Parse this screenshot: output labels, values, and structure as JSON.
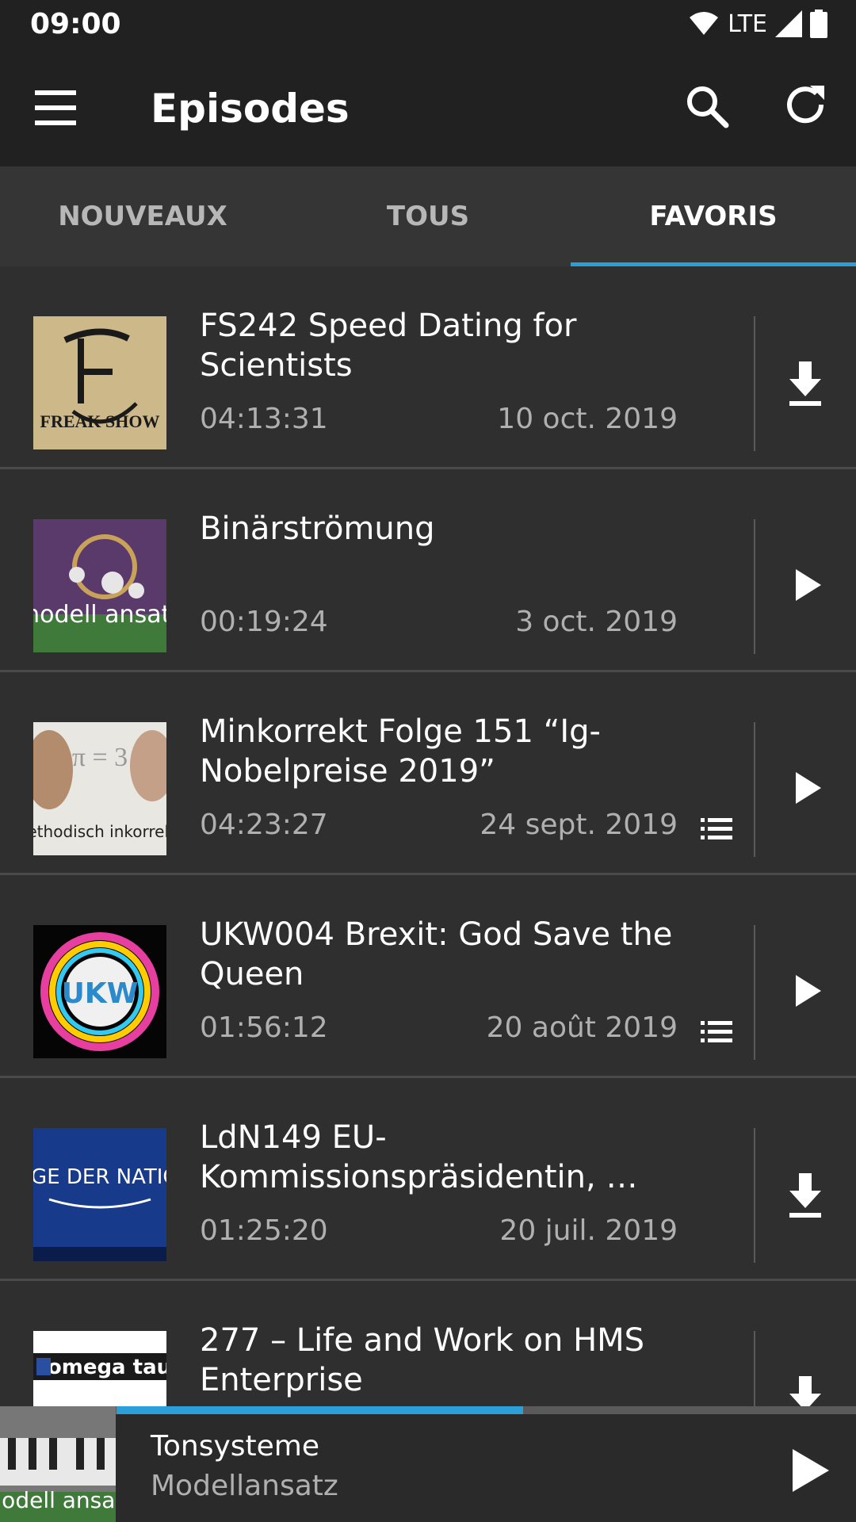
{
  "status_bar": {
    "time": "09:00",
    "network": "LTE",
    "icons": [
      "wifi-icon",
      "signal-icon",
      "battery-icon"
    ]
  },
  "toolbar": {
    "title": "Episodes",
    "icons": [
      "menu-icon",
      "search-icon",
      "refresh-icon"
    ]
  },
  "tabs": [
    {
      "label": "NOUVEAUX",
      "active": false
    },
    {
      "label": "TOUS",
      "active": false
    },
    {
      "label": "FAVORIS",
      "active": true
    }
  ],
  "episodes": [
    {
      "title": "FS242 Speed Dating for Scientists",
      "duration": "04:13:31",
      "date": "10 oct. 2019",
      "action": "download-icon",
      "has_chapters": false,
      "thumb_text": "FREAK SHOW"
    },
    {
      "title": "Binärströmung",
      "duration": "00:19:24",
      "date": "3 oct. 2019",
      "action": "play-icon",
      "has_chapters": false,
      "thumb_text": "modell ansatz"
    },
    {
      "title": "Minkorrekt Folge 151 “Ig-Nobelpreise 2019”",
      "duration": "04:23:27",
      "date": "24 sept. 2019",
      "action": "play-icon",
      "has_chapters": true,
      "thumb_text": "Methodisch inkorrekt!"
    },
    {
      "title": "UKW004 Brexit: God Save the Queen",
      "duration": "01:56:12",
      "date": "20 août 2019",
      "action": "play-icon",
      "has_chapters": true,
      "thumb_text": "UKW"
    },
    {
      "title": "LdN149 EU-Kommissionspräsidentin, …",
      "duration": "01:25:20",
      "date": "20 juil. 2019",
      "action": "download-icon",
      "has_chapters": false,
      "thumb_text": "LAGE DER NATION"
    },
    {
      "title": "277 – Life and Work on HMS Enterprise",
      "duration": "",
      "date": "",
      "action": "download-icon",
      "has_chapters": false,
      "thumb_text": "omega tau"
    }
  ],
  "player": {
    "track": "Tonsysteme",
    "podcast": "Modellansatz",
    "progress_fraction": 0.475,
    "art_text": "modell ansatz"
  },
  "colors": {
    "accent": "#2c9fd8",
    "background": "#2f2f2f",
    "bar": "#212121"
  }
}
